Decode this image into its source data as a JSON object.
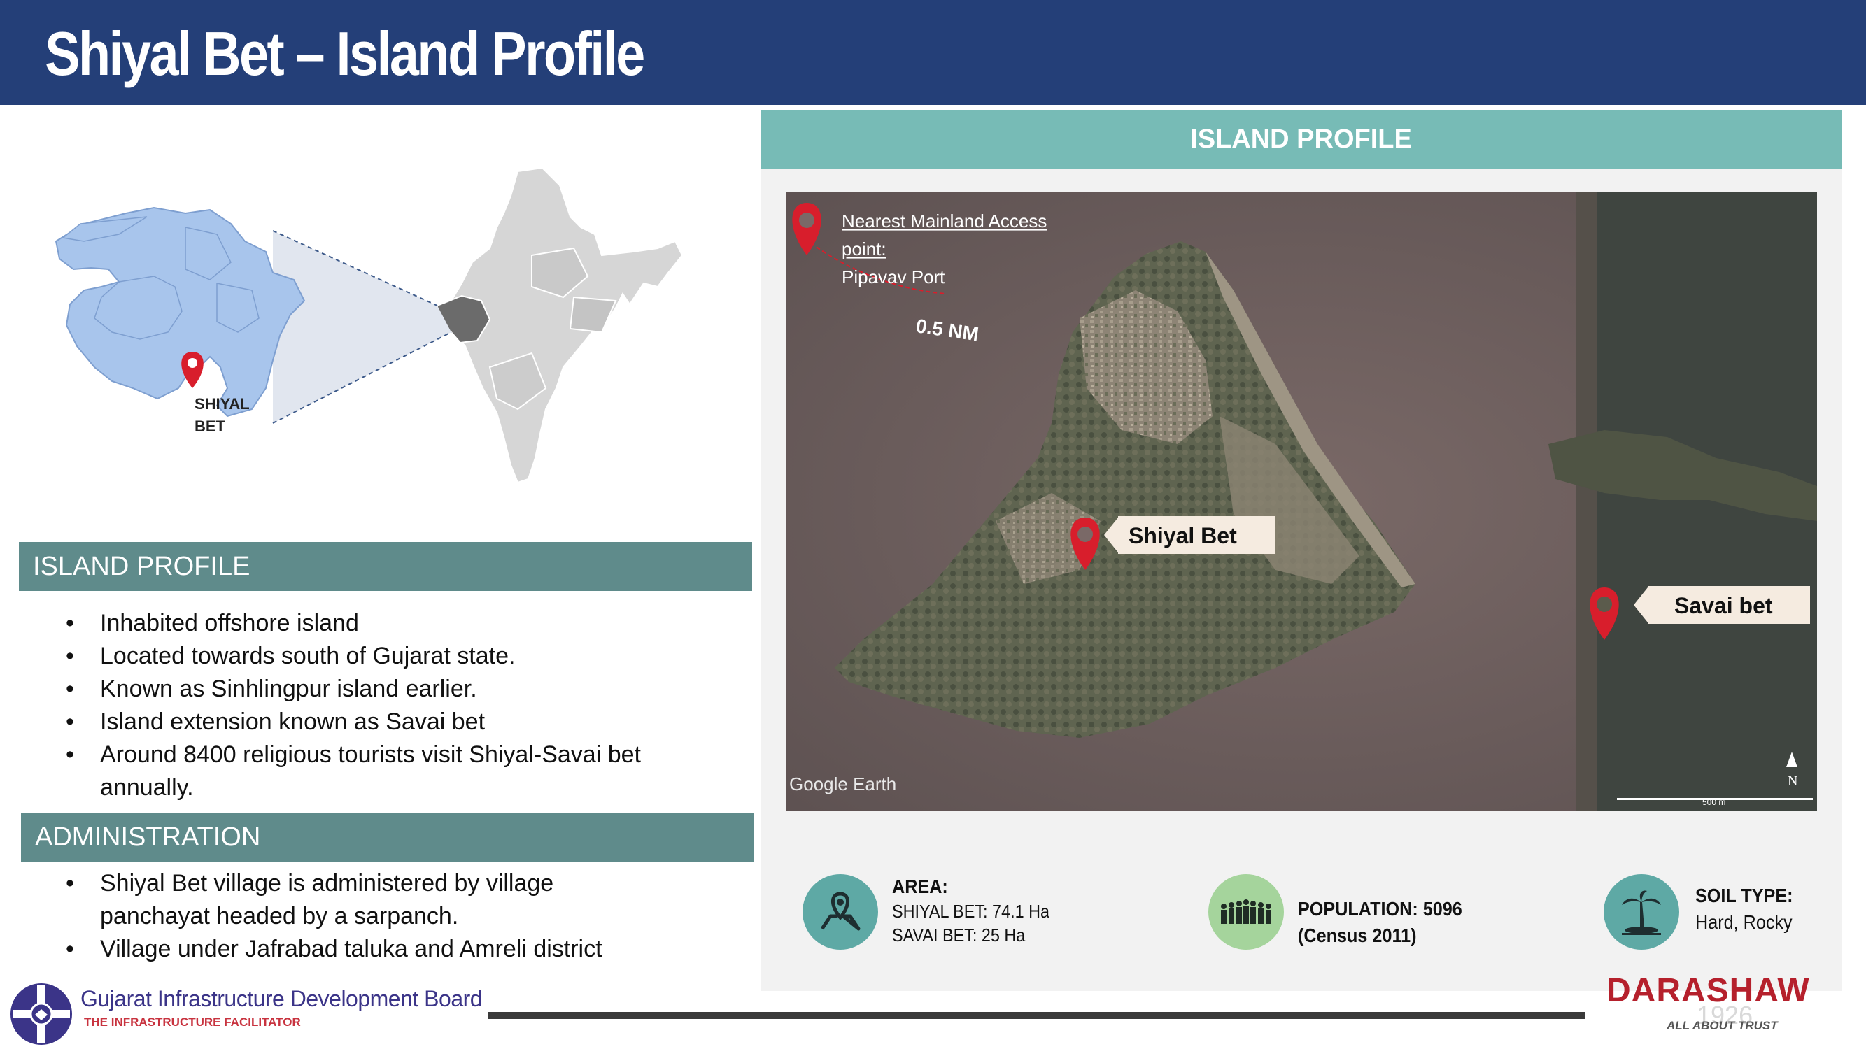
{
  "title": "Shiyal Bet – Island Profile",
  "map": {
    "marker_label_line1": "SHIYAL",
    "marker_label_line2": "BET"
  },
  "profile": {
    "header": "ISLAND PROFILE",
    "bullets": [
      "Inhabited offshore island",
      "Located towards south of Gujarat state.",
      "Known as Sinhlingpur island earlier.",
      "Island extension known as Savai bet",
      "Around 8400 religious tourists visit Shiyal-Savai bet",
      "annually."
    ]
  },
  "administration": {
    "header": "ADMINISTRATION",
    "bullets": [
      "Shiyal Bet village is administered by village",
      "panchayat headed by a sarpanch.",
      "Village under Jafrabad taluka and Amreli district"
    ]
  },
  "right_panel": {
    "header": "ISLAND PROFILE",
    "satellite": {
      "access_title_line1": "Nearest Mainland Access",
      "access_title_line2": "point:",
      "access_place": "Pipavav Port",
      "distance": "0.5 NM",
      "shiyal_label": "Shiyal Bet",
      "savai_label": "Savai bet",
      "watermark": "Google Earth",
      "north": "N",
      "scale": "500 m"
    },
    "stats": {
      "area": {
        "label": "AREA:",
        "line1": "SHIYAL BET: 74.1 Ha",
        "line2": "SAVAI BET: 25 Ha"
      },
      "population": {
        "line1": "POPULATION: 5096",
        "line2": "(Census 2011)"
      },
      "soil": {
        "label": "SOIL TYPE:",
        "value": "Hard, Rocky"
      }
    }
  },
  "footer": {
    "org_name": "Gujarat Infrastructure Development Board",
    "org_tagline": "THE INFRASTRUCTURE FACILITATOR",
    "brand": "DARASHAW",
    "brand_year": "1926",
    "brand_tagline": "ALL ABOUT TRUST"
  },
  "colors": {
    "title_bar": "#243f78",
    "section_header": "#5f8b8b",
    "panel_header": "#77bbb6",
    "stat_circle": "#5ea9a5",
    "population_circle": "#a5d49c",
    "marker_red": "#d81e2c"
  }
}
